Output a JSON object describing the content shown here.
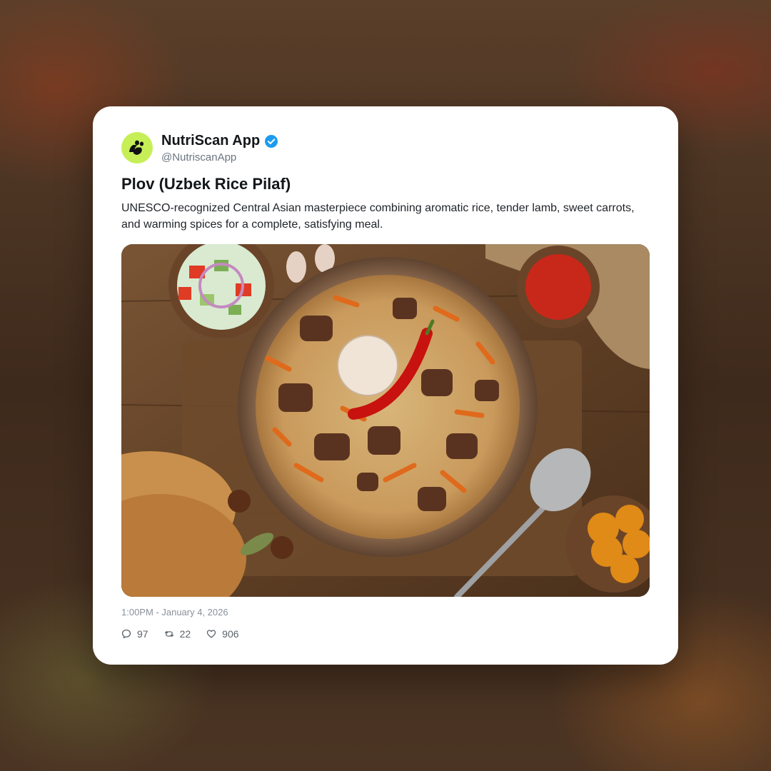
{
  "account": {
    "display_name": "NutriScan App",
    "handle": "@NutriscanApp",
    "verified": true,
    "avatar_color": "#c6ef57"
  },
  "post": {
    "title": "Plov (Uzbek Rice Pilaf)",
    "text": "UNESCO-recognized Central Asian masterpiece combining aromatic rice, tender lamb, sweet carrots, and warming spices for a complete, satisfying meal.",
    "timestamp": "1:00PM - January 4, 2026"
  },
  "stats": {
    "replies": "97",
    "reposts": "22",
    "likes": "906"
  },
  "icons": {
    "avatar": "leaf-logo-icon",
    "verified": "verified-badge-icon",
    "reply": "reply-icon",
    "repost": "repost-icon",
    "like": "heart-icon"
  },
  "colors": {
    "verified_badge": "#1d9bf0",
    "card_background": "#ffffff",
    "muted_text": "#6b7580"
  }
}
